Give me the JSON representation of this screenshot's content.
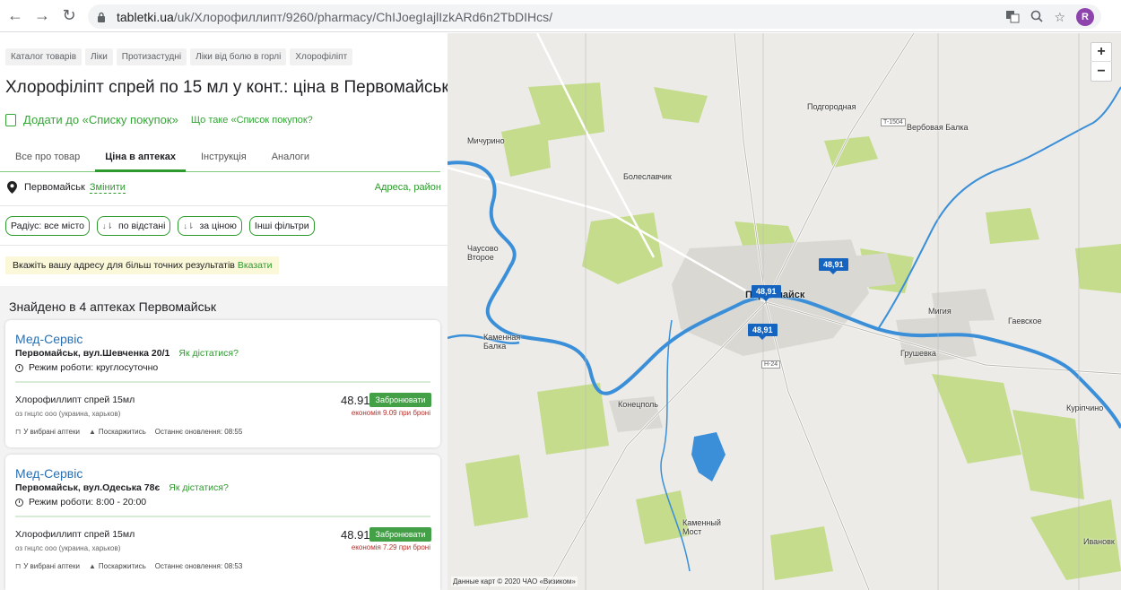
{
  "browser": {
    "url_domain": "tabletki.ua",
    "url_path": "/uk/Хлорофиллипт/9260/pharmacy/ChIJoegIajlIzkARd6n2TbDIHcs/",
    "profile_initial": "R"
  },
  "breadcrumbs": [
    "Каталог товарів",
    "Ліки",
    "Протизастудні",
    "Ліки від болю в горлі",
    "Хлорофіліпт"
  ],
  "page_title": "Хлорофіліпт спрей по 15 мл у конт.: ціна в Первомайськ",
  "shopping_list": {
    "add_label": "Додати до «Списку покупок»",
    "what_label": "Що таке «Список покупок?"
  },
  "tabs": [
    {
      "label": "Все про товар",
      "active": false
    },
    {
      "label": "Ціна в аптеках",
      "active": true
    },
    {
      "label": "Інструкція",
      "active": false
    },
    {
      "label": "Аналоги",
      "active": false
    }
  ],
  "location": {
    "city": "Первомайськ",
    "change_label": "Змінити",
    "address_label": "Адреса, район"
  },
  "filters": {
    "radius": "Радіус: все місто",
    "by_distance": "по відстані",
    "by_price": "за ціною",
    "other": "Інші фільтри",
    "sort_glyph": "↓⇂"
  },
  "hint": {
    "text": "Вкажіть вашу адресу для більш точних результатів",
    "link": "Вказати"
  },
  "found_text": "Знайдено в 4 аптеках Первомайськ",
  "pharmacies": [
    {
      "name": "Мед-Сервіс",
      "address": "Первомайськ, вул.Шевченка 20/1",
      "route_label": "Як дістатися?",
      "hours": "Режим роботи: круглосуточно",
      "product": "Хлорофиллипт спрей 15мл",
      "maker": "оз гнцлс ооо (украина, харьков)",
      "price": "48.91",
      "book_label": "Забронювати",
      "saving": "економія 9.09 при броні",
      "favorite_label": "У вибрані аптеки",
      "complain_label": "Поскаржитись",
      "updated": "Останнє оновлення: 08:55"
    },
    {
      "name": "Мед-Сервіс",
      "address": "Первомайськ, вул.Одеська 78є",
      "route_label": "Як дістатися?",
      "hours": "Режим роботи: 8:00 - 20:00",
      "product": "Хлорофиллипт спрей 15мл",
      "maker": "оз гнцлс ооо (украина, харьков)",
      "price": "48.91",
      "book_label": "Забронювати",
      "saving": "економія 7.29 при броні",
      "favorite_label": "У вибрані аптеки",
      "complain_label": "Поскаржитись",
      "updated": "Останнє оновлення: 08:53"
    }
  ],
  "map": {
    "zoom_in": "+",
    "zoom_out": "−",
    "places": [
      "Подгородная",
      "Вербовая Балка",
      "Мичурино",
      "Болеславчик",
      "Чаусово Второе",
      "Первомайск",
      "Мигия",
      "Гаевское",
      "Каменная Балка",
      "Грушевка",
      "Конецполь",
      "Куріпчино",
      "Каменный Мост",
      "Ивановк"
    ],
    "price_markers": [
      "48,91",
      "48,91",
      "48,91"
    ],
    "road_labels": [
      "T-1504",
      "H-24"
    ],
    "credit": "Данные карт © 2020 ЧАО «Визиком»",
    "colors": {
      "water": "#3a8fd8",
      "green": "#c4dc8c",
      "urban": "#dcdcd6",
      "marker": "#1565c0"
    }
  },
  "colors": {
    "accent_green": "#2e9a2e",
    "link_blue": "#2a6fb0",
    "book_button": "#43a047",
    "saving_red": "#b5322c"
  }
}
